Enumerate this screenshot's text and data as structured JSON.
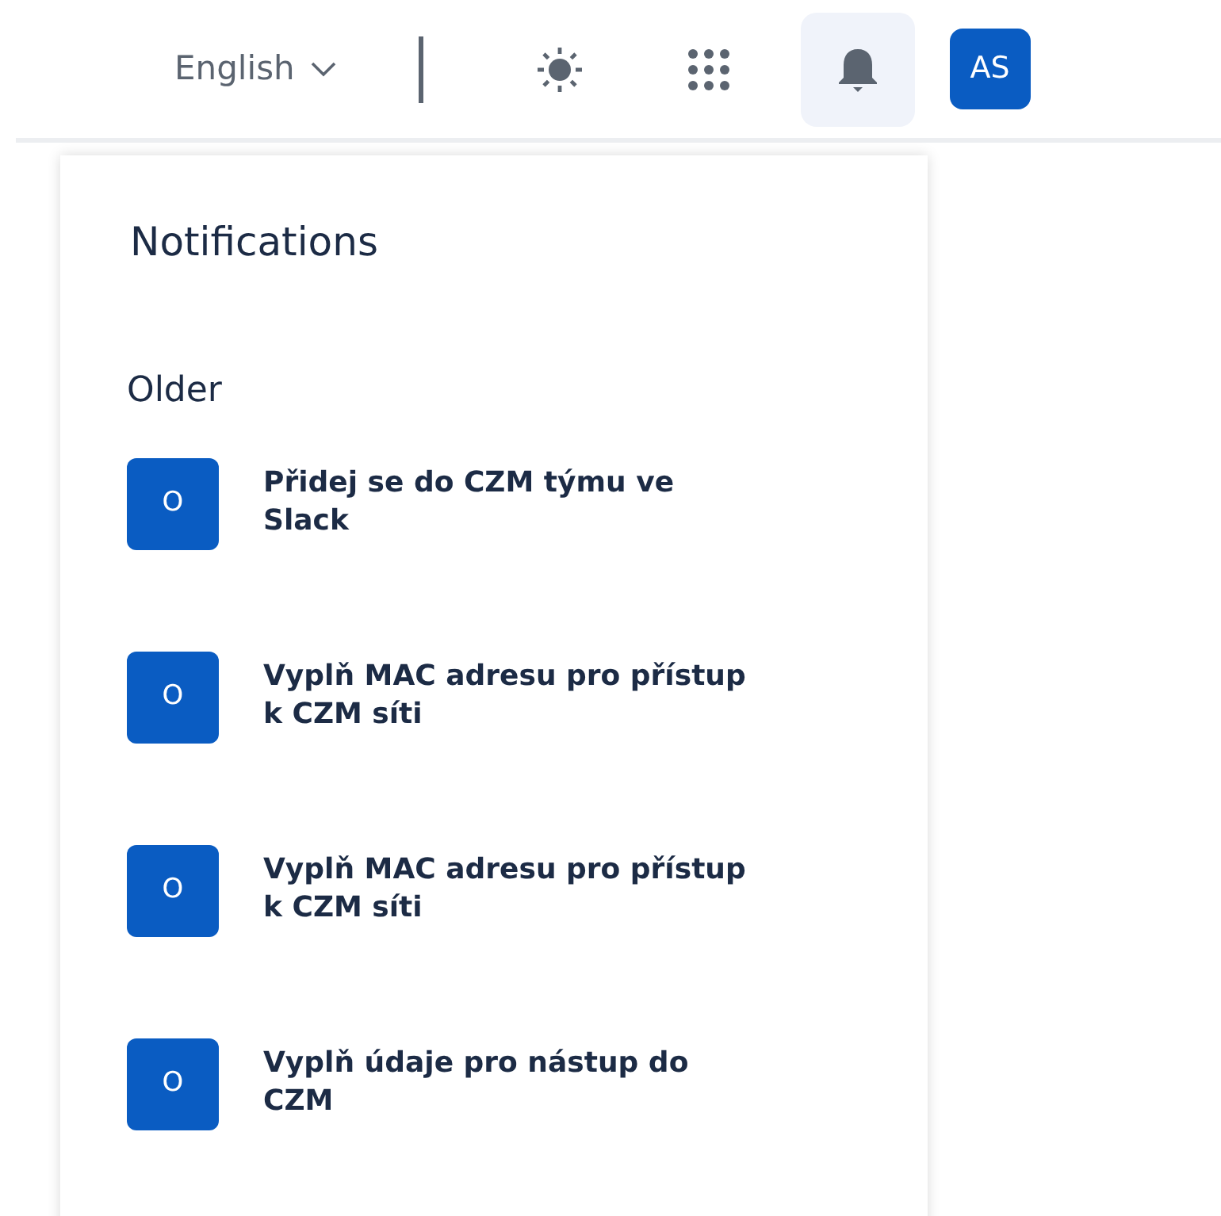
{
  "header": {
    "language": "English",
    "buttons": [
      {
        "kind": "theme",
        "selected": false
      },
      {
        "kind": "apps",
        "selected": false
      },
      {
        "kind": "notifications",
        "selected": true
      }
    ],
    "avatar": "AS"
  },
  "notifications": {
    "title": "Notifications",
    "section": "Older",
    "items": [
      {
        "initial": "O",
        "text": "Přidej se do CZM týmu ve Slack"
      },
      {
        "initial": "O",
        "text": "Vyplň MAC adresu pro přístup k CZM síti"
      },
      {
        "initial": "O",
        "text": "Vyplň MAC adresu pro přístup k CZM síti"
      },
      {
        "initial": "O",
        "text": "Vyplň údaje pro nástup do CZM"
      }
    ]
  }
}
